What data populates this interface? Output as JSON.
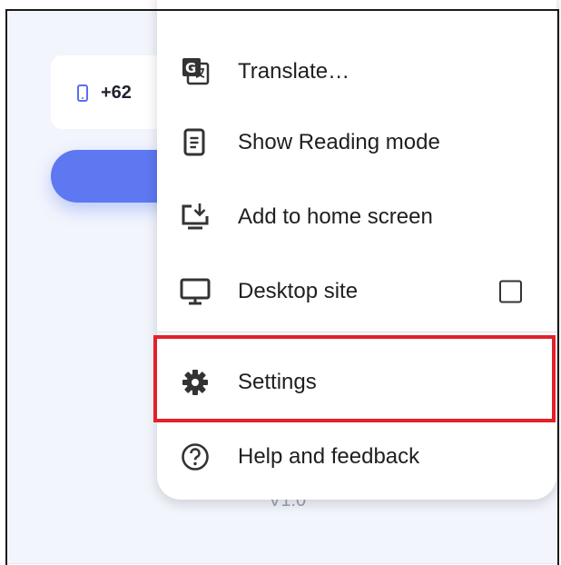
{
  "login": {
    "phone_code": "+62",
    "version": "V1.0"
  },
  "menu": {
    "items": [
      {
        "label": "Translate…",
        "icon": "translate-icon"
      },
      {
        "label": "Show Reading mode",
        "icon": "reading-mode-icon"
      },
      {
        "label": "Add to home screen",
        "icon": "add-to-home-screen-icon"
      },
      {
        "label": "Desktop site",
        "icon": "desktop-icon",
        "checkbox_checked": false
      },
      {
        "label": "Settings",
        "icon": "gear-icon",
        "highlighted": true
      },
      {
        "label": "Help and feedback",
        "icon": "help-icon"
      }
    ]
  },
  "colors": {
    "accent": "#5d78f0",
    "highlight": "#e3202a",
    "background": "#f2f5fc"
  }
}
